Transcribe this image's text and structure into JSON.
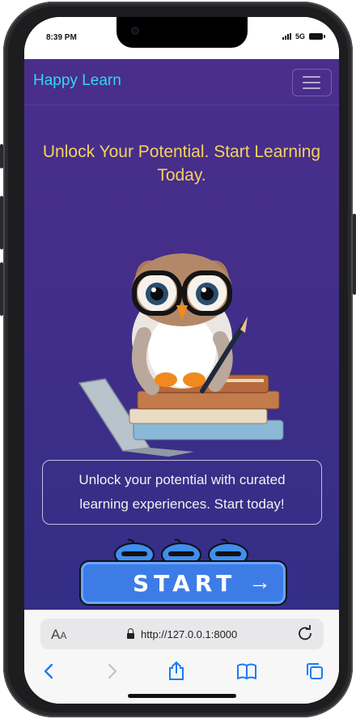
{
  "status": {
    "time": "8:39 PM",
    "network": "5G"
  },
  "nav": {
    "brand": "Happy Learn"
  },
  "hero": {
    "headline": "Unlock Your Potential. Start Learning Today."
  },
  "card": {
    "text": "Unlock your potential with curated learning experiences. Start today!"
  },
  "start_button": {
    "label": "START",
    "arrow": "→"
  },
  "browser": {
    "text_size_label": "A",
    "text_size_small": "A",
    "url": "http://127.0.0.1:8000"
  },
  "colors": {
    "brand": "#33d6f5",
    "headline": "#f4d25c",
    "background": "#45308c",
    "button": "#3d7ce6"
  }
}
